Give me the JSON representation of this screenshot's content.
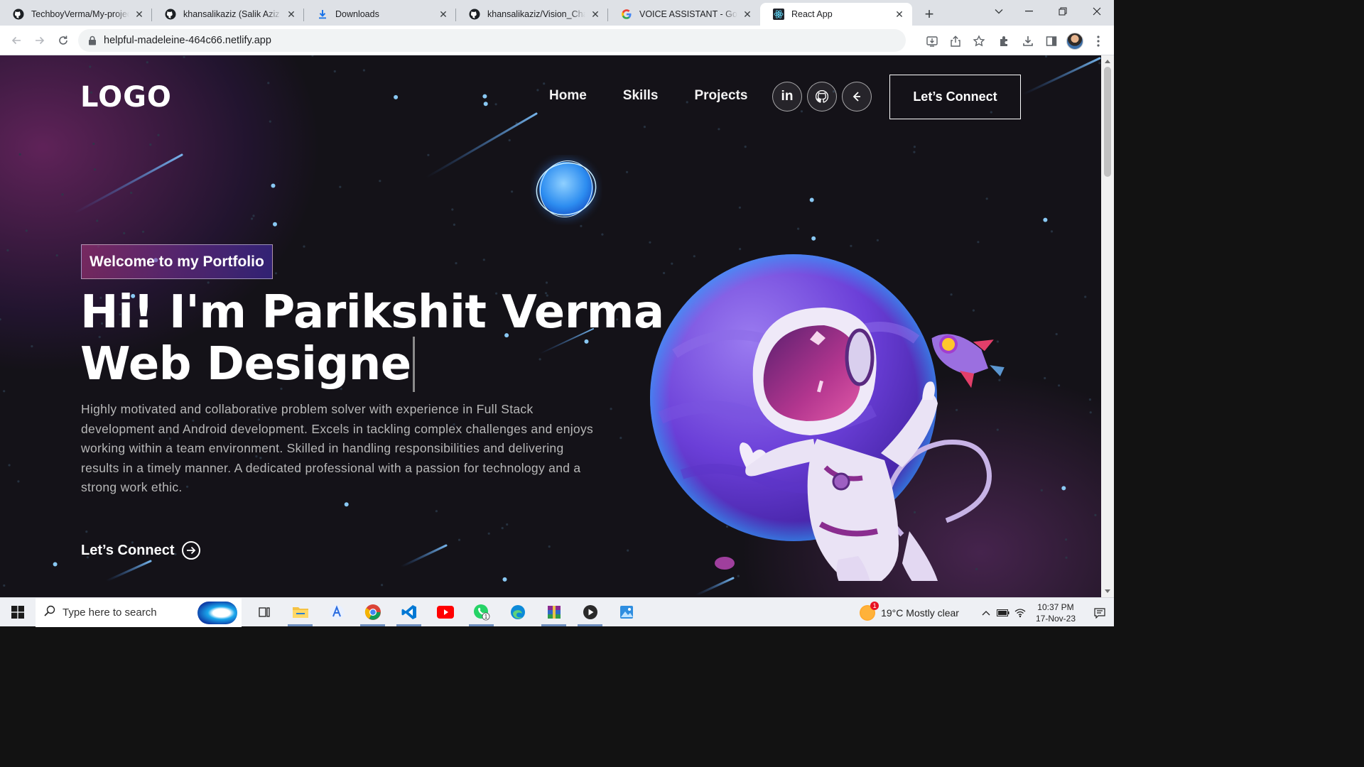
{
  "browser": {
    "tabs": [
      {
        "title": "TechboyVerma/My-project",
        "icon": "github-icon",
        "active": false
      },
      {
        "title": "khansalikaziz (Salik Aziz Khan)",
        "icon": "github-icon",
        "active": false
      },
      {
        "title": "Downloads",
        "icon": "download-icon",
        "active": false
      },
      {
        "title": "khansalikaziz/Vision_Chat-Gpt",
        "icon": "github-icon",
        "active": false
      },
      {
        "title": "VOICE ASSISTANT - Google",
        "icon": "google-icon",
        "active": false
      },
      {
        "title": "React App",
        "icon": "react-icon",
        "active": true
      }
    ],
    "new_tab": "+",
    "url": "helpful-madeleine-464c66.netlify.app"
  },
  "page": {
    "logo": "LOGO",
    "nav": [
      "Home",
      "Skills",
      "Projects"
    ],
    "social": [
      {
        "name": "linkedin-icon",
        "glyph": "in"
      },
      {
        "name": "github-icon",
        "glyph": ""
      },
      {
        "name": "fiverr-icon",
        "glyph": ""
      }
    ],
    "connect_button": "Let’s Connect",
    "tagline": "Welcome to my Portfolio",
    "headline_line1": "Hi! I'm Parikshit Verma",
    "headline_line2": "Web Designe",
    "description": "Highly motivated and collaborative problem solver with experience in Full Stack development and Android development. Excels in tackling complex challenges and enjoys working within a team environment. Skilled in handling responsibilities and delivering results in a timely manner. A dedicated professional with a passion for technology and a strong work ethic.",
    "cta": "Let’s Connect"
  },
  "taskbar": {
    "search_placeholder": "Type here to search",
    "weather": "19°C  Mostly clear",
    "time": "10:37 PM",
    "date": "17-Nov-23",
    "whatsapp_badge": "1"
  },
  "colors": {
    "accent_purple": "#4a2fbd",
    "accent_magenta": "#aa367c",
    "page_bg": "#121212"
  }
}
